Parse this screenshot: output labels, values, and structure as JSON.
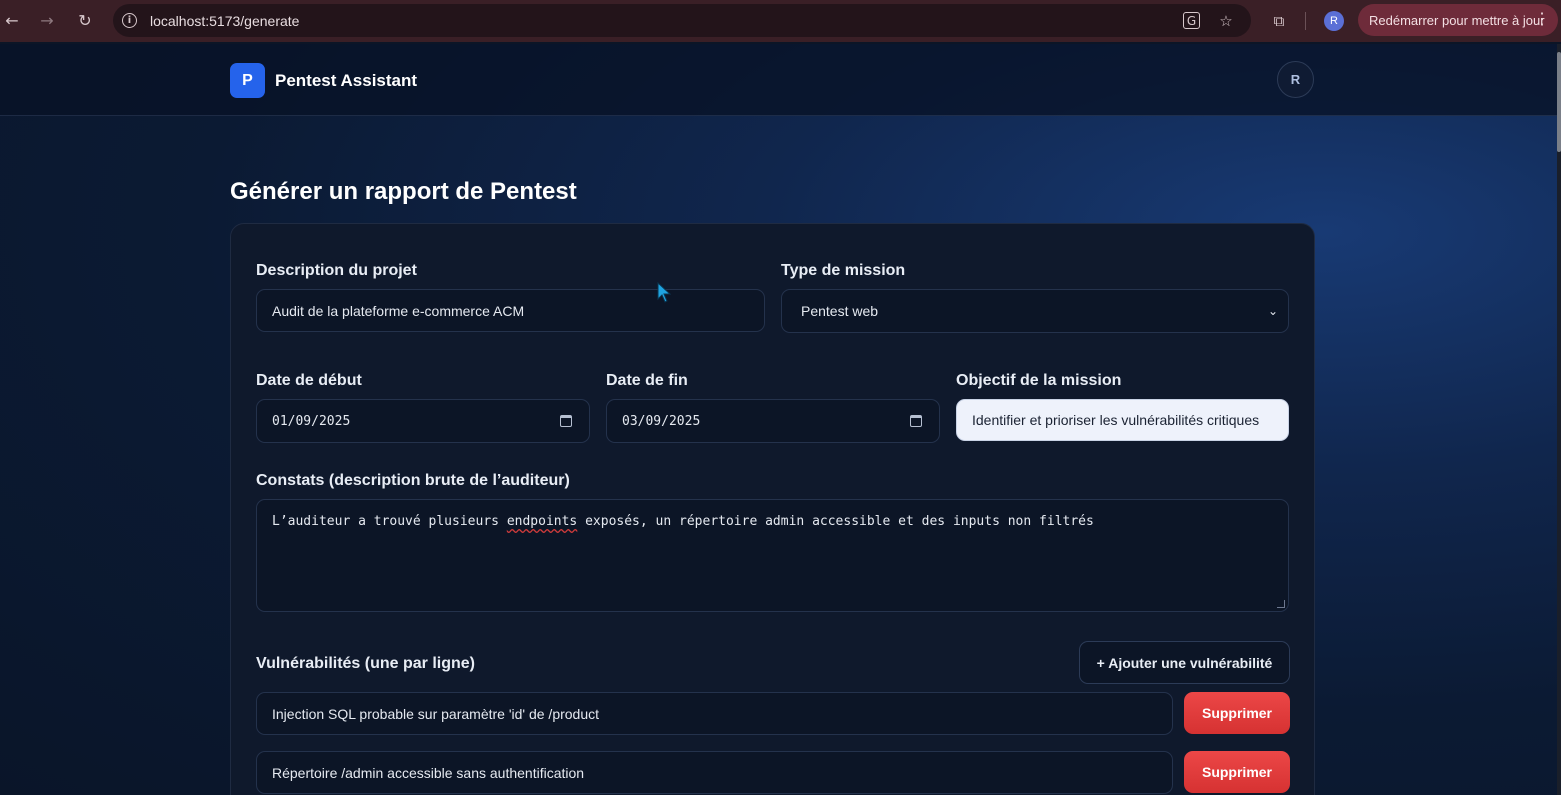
{
  "browser": {
    "url": "localhost:5173/generate",
    "update_label": "Redémarrer pour mettre à jour",
    "profile_initial": "R"
  },
  "header": {
    "logo_letter": "P",
    "app_name": "Pentest Assistant",
    "user_initial": "R"
  },
  "page": {
    "title": "Générer un rapport de Pentest"
  },
  "form": {
    "description_label": "Description du projet",
    "description_value": "Audit de la plateforme e-commerce ACM",
    "mission_type_label": "Type de mission",
    "mission_type_value": "Pentest web",
    "start_date_label": "Date de début",
    "start_date_value": "01/09/2025",
    "end_date_label": "Date de fin",
    "end_date_value": "03/09/2025",
    "objective_label": "Objectif de la mission",
    "objective_value": "Identifier et prioriser les vulnérabilités critiques",
    "findings_label": "Constats (description brute de l’auditeur)",
    "findings_before": "L’auditeur a trouvé plusieurs ",
    "findings_misspelled": "endpoints",
    "findings_after": " exposés, un répertoire admin accessible et des inputs non filtrés",
    "vulns_label": "Vulnérabilités (une par ligne)",
    "add_vuln_label": "+ Ajouter une vulnérabilité",
    "vulnerabilities": [
      {
        "value": "Injection SQL probable sur paramètre 'id' de /product",
        "delete_label": "Supprimer"
      },
      {
        "value": "Répertoire /admin accessible sans authentification",
        "delete_label": "Supprimer"
      }
    ]
  },
  "colors": {
    "accent": "#2563eb",
    "danger": "#e23b3b",
    "update_pill": "#6e2b3a"
  },
  "icons": [
    "back-arrow-icon",
    "forward-arrow-icon",
    "reload-icon",
    "info-icon",
    "translate-icon",
    "star-icon",
    "extensions-icon",
    "calendar-icon",
    "chevron-down-icon",
    "mouse-cursor-icon"
  ]
}
